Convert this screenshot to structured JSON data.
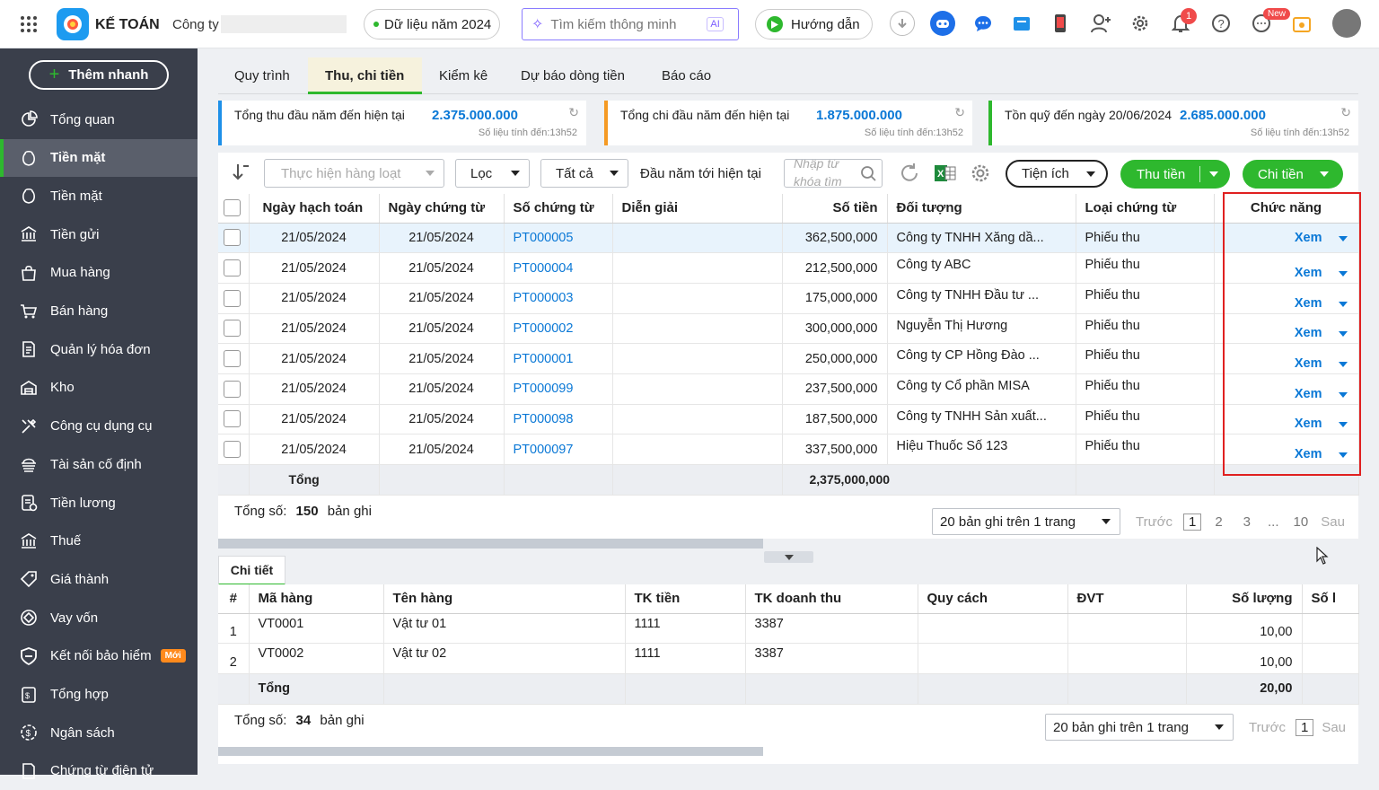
{
  "app": {
    "logo_text": "KẾ TOÁN",
    "company_label": "Công ty",
    "data_year": "Dữ liệu năm 2024",
    "search_placeholder": "Tìm kiếm thông minh",
    "search_ai": "AI",
    "guide": "Hướng dẫn",
    "notif_count": "1",
    "new_badge": "New"
  },
  "sidebar": {
    "quick_add": "Thêm nhanh",
    "items": [
      {
        "label": "Tổng quan",
        "icon": "dashboard-icon"
      },
      {
        "label": "Tiền mặt",
        "icon": "cash-icon",
        "active": true
      },
      {
        "label": "Tiền mặt",
        "icon": "cash-icon"
      },
      {
        "label": "Tiền gửi",
        "icon": "bank-icon"
      },
      {
        "label": "Mua hàng",
        "icon": "bag-icon"
      },
      {
        "label": "Bán hàng",
        "icon": "cart-icon"
      },
      {
        "label": "Quản lý hóa đơn",
        "icon": "invoice-icon"
      },
      {
        "label": "Kho",
        "icon": "warehouse-icon"
      },
      {
        "label": "Công cụ dụng cụ",
        "icon": "tools-icon"
      },
      {
        "label": "Tài sản cố định",
        "icon": "asset-icon"
      },
      {
        "label": "Tiền lương",
        "icon": "salary-icon"
      },
      {
        "label": "Thuế",
        "icon": "tax-icon"
      },
      {
        "label": "Giá thành",
        "icon": "price-tag-icon"
      },
      {
        "label": "Vay vốn",
        "icon": "loan-icon"
      },
      {
        "label": "Kết nối bảo hiểm",
        "icon": "shield-icon",
        "badge": "Mới"
      },
      {
        "label": "Tổng hợp",
        "icon": "summary-icon"
      },
      {
        "label": "Ngân sách",
        "icon": "budget-icon"
      },
      {
        "label": "Chứng từ điện tử",
        "icon": "document-icon"
      }
    ]
  },
  "tabs": [
    "Quy trình",
    "Thu, chi tiền",
    "Kiểm kê",
    "Dự báo dòng tiền",
    "Báo cáo"
  ],
  "stats": [
    {
      "label": "Tổng thu đầu năm đến hiện tại",
      "value": "2.375.000.000",
      "sub": "Số liệu tính đến:13h52",
      "color": "#1e90e8"
    },
    {
      "label": "Tổng chi đầu năm đến hiện tại",
      "value": "1.875.000.000",
      "sub": "Số liệu tính đến:13h52",
      "color": "#f59a23"
    },
    {
      "label": "Tồn quỹ đến ngày 20/06/2024",
      "value": "2.685.000.000",
      "sub": "Số liệu tính đến:13h52",
      "color": "#2eb82e"
    }
  ],
  "toolbar": {
    "batch": "Thực hiện hàng loạt",
    "filter": "Lọc",
    "all": "Tất cả",
    "period": "Đầu năm tới hiện tại",
    "keyword_placeholder": "Nhập từ khóa tìm kiếm",
    "utilities": "Tiện ích",
    "receive": "Thu tiền",
    "pay": "Chi tiền"
  },
  "grid": {
    "columns": [
      "Ngày hạch toán",
      "Ngày chứng từ",
      "Số chứng từ",
      "Diễn giải",
      "Số tiền",
      "Đối tượng",
      "Loại chứng từ",
      "Chức năng"
    ],
    "rows": [
      {
        "post_date": "21/05/2024",
        "doc_date": "21/05/2024",
        "doc_no": "PT000005",
        "desc": "",
        "amount": "362,500,000",
        "object": "Công ty TNHH Xăng dầ...",
        "type": "Phiếu thu",
        "action": "Xem"
      },
      {
        "post_date": "21/05/2024",
        "doc_date": "21/05/2024",
        "doc_no": "PT000004",
        "desc": "",
        "amount": "212,500,000",
        "object": "Công ty ABC",
        "type": "Phiếu thu",
        "action": "Xem"
      },
      {
        "post_date": "21/05/2024",
        "doc_date": "21/05/2024",
        "doc_no": "PT000003",
        "desc": "",
        "amount": "175,000,000",
        "object": "Công ty TNHH Đầu tư ...",
        "type": "Phiếu thu",
        "action": "Xem"
      },
      {
        "post_date": "21/05/2024",
        "doc_date": "21/05/2024",
        "doc_no": "PT000002",
        "desc": "",
        "amount": "300,000,000",
        "object": "Nguyễn Thị Hương",
        "type": "Phiếu thu",
        "action": "Xem"
      },
      {
        "post_date": "21/05/2024",
        "doc_date": "21/05/2024",
        "doc_no": "PT000001",
        "desc": "",
        "amount": "250,000,000",
        "object": "Công ty CP Hồng Đào ...",
        "type": "Phiếu thu",
        "action": "Xem"
      },
      {
        "post_date": "21/05/2024",
        "doc_date": "21/05/2024",
        "doc_no": "PT000099",
        "desc": "",
        "amount": "237,500,000",
        "object": "Công ty Cổ phần MISA",
        "type": "Phiếu thu",
        "action": "Xem"
      },
      {
        "post_date": "21/05/2024",
        "doc_date": "21/05/2024",
        "doc_no": "PT000098",
        "desc": "",
        "amount": "187,500,000",
        "object": "Công ty TNHH Sản xuất...",
        "type": "Phiếu thu",
        "action": "Xem"
      },
      {
        "post_date": "21/05/2024",
        "doc_date": "21/05/2024",
        "doc_no": "PT000097",
        "desc": "",
        "amount": "337,500,000",
        "object": "Hiệu Thuốc Số 123",
        "type": "Phiếu thu",
        "action": "Xem"
      }
    ],
    "total_label": "Tổng",
    "total_amount": "2,375,000,000",
    "count_label": "Tổng số:",
    "count": "150",
    "count_unit": "bản ghi",
    "page_size": "20 bản ghi trên 1 trang",
    "prev": "Trước",
    "next": "Sau",
    "pages": [
      "1",
      "2",
      "3",
      "...",
      "10"
    ]
  },
  "detail": {
    "tab": "Chi tiết",
    "columns": [
      "#",
      "Mã hàng",
      "Tên hàng",
      "TK tiền",
      "TK doanh thu",
      "Quy cách",
      "ĐVT",
      "Số lượng",
      "Số l"
    ],
    "rows": [
      {
        "no": "1",
        "code": "VT0001",
        "name": "Vật tư 01",
        "cash_acc": "1111",
        "rev_acc": "3387",
        "spec": "",
        "unit": "",
        "qty": "10,00"
      },
      {
        "no": "2",
        "code": "VT0002",
        "name": "Vật tư 02",
        "cash_acc": "1111",
        "rev_acc": "3387",
        "spec": "",
        "unit": "",
        "qty": "10,00"
      }
    ],
    "total_label": "Tổng",
    "total_qty": "20,00",
    "count_label": "Tổng số:",
    "count": "34",
    "count_unit": "bản ghi",
    "page_size": "20 bản ghi trên 1 trang",
    "prev": "Trước",
    "page": "1",
    "next": "Sau"
  },
  "colors": {
    "accent": "#2eb82e",
    "link": "#0a78d6",
    "highlight": "#e02020",
    "sidebar": "#3a3f4b"
  }
}
